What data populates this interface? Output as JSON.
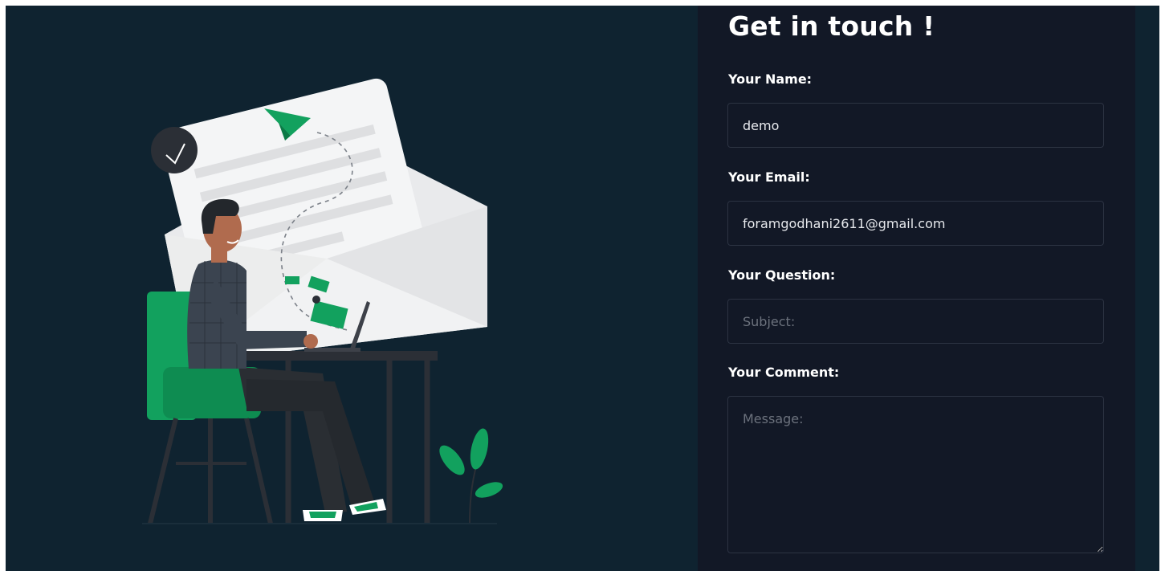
{
  "form": {
    "title": "Get in touch !",
    "name_label": "Your Name:",
    "name_value": "demo",
    "email_label": "Your Email:",
    "email_value": "foramgodhani2611@gmail.com",
    "question_label": "Your Question:",
    "question_placeholder": "Subject:",
    "comment_label": "Your Comment:",
    "comment_placeholder": "Message:"
  },
  "colors": {
    "page_background": "#0f2330",
    "panel_background": "#121826",
    "input_border": "#2c3342",
    "accent_green": "#12a15e"
  },
  "illustration": {
    "icons": [
      "clock-icon",
      "paper-plane-icon",
      "envelope-icon",
      "laptop-icon",
      "plant-icon"
    ]
  }
}
